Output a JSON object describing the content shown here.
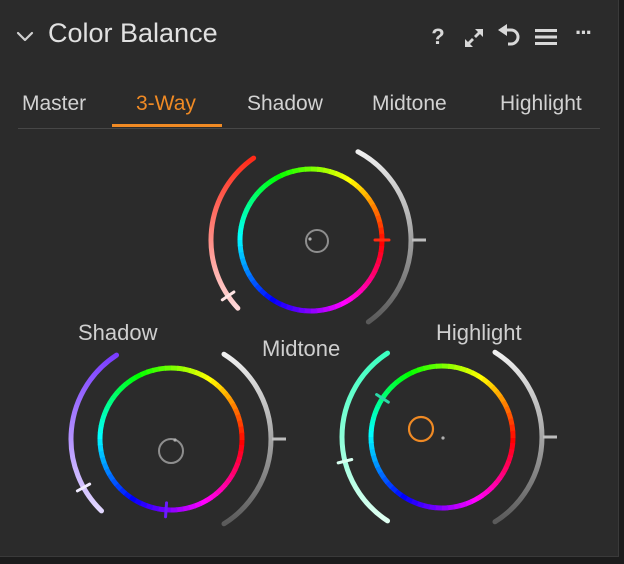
{
  "panel": {
    "title": "Color Balance",
    "icons": [
      "chevron-down-icon",
      "help-icon",
      "expand-icon",
      "reset-icon",
      "menu-icon",
      "more-icon"
    ],
    "help_glyph": "?",
    "more_glyph": "···"
  },
  "tabs": [
    {
      "label": "Master",
      "active": false
    },
    {
      "label": "3-Way",
      "active": true
    },
    {
      "label": "Shadow",
      "active": false
    },
    {
      "label": "Midtone",
      "active": false
    },
    {
      "label": "Highlight",
      "active": false
    }
  ],
  "wheels": {
    "midtone": {
      "label": "Midtone"
    },
    "shadow": {
      "label": "Shadow"
    },
    "highlight": {
      "label": "Highlight"
    }
  },
  "colors": {
    "accent": "#f08a24",
    "panel_bg": "#2b2b2b",
    "text": "#d2d2d2"
  }
}
